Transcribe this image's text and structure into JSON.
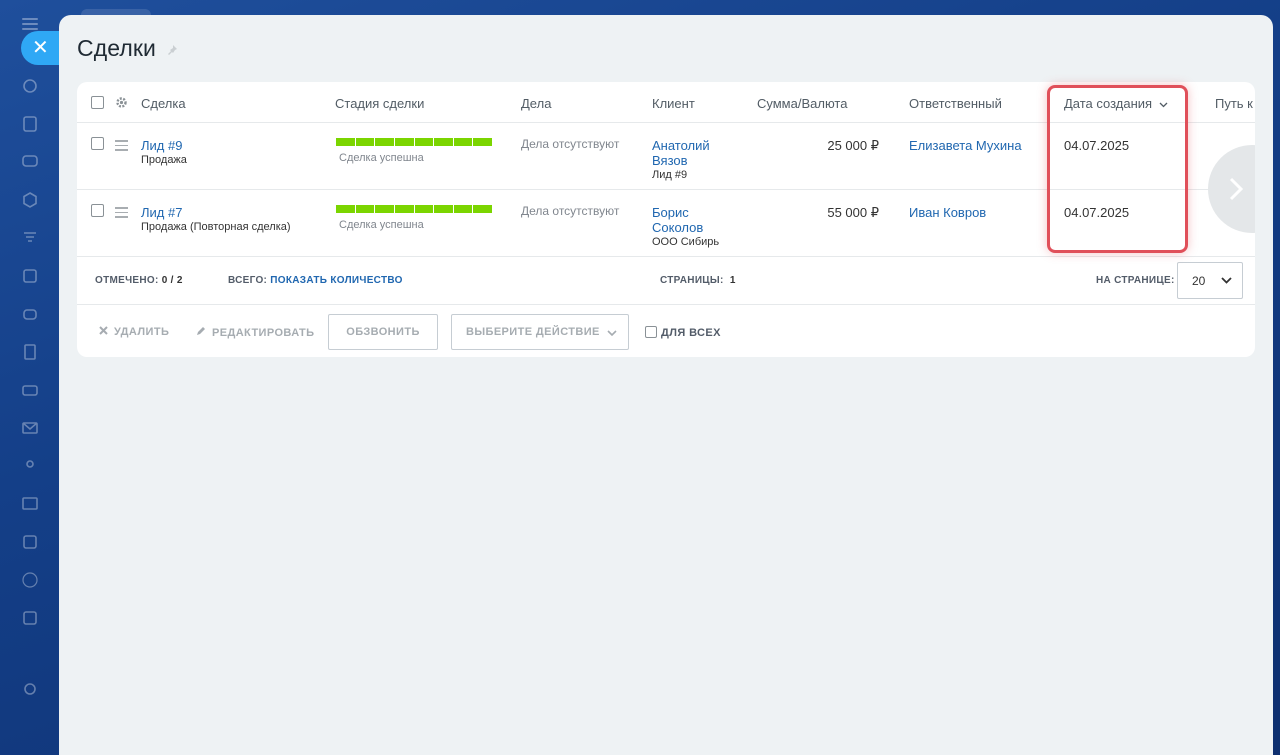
{
  "page": {
    "title": "Сделки"
  },
  "table": {
    "headers": {
      "deal": "Сделка",
      "stage": "Стадия сделки",
      "activities": "Дела",
      "client": "Клиент",
      "amount": "Сумма/Валюта",
      "responsible": "Ответственный",
      "created": "Дата создания",
      "path": "Путь к"
    },
    "rows": [
      {
        "title": "Лид #9",
        "type": "Продажа",
        "stage_label": "Сделка успешна",
        "activities": "Дела отсутствуют",
        "client_line1": "Анатолий",
        "client_line2": "Вязов",
        "client_sub": "Лид #9",
        "amount": "25 000 ₽",
        "responsible": "Елизавета Мухина",
        "created": "04.07.2025"
      },
      {
        "title": "Лид #7",
        "type": "Продажа (Повторная сделка)",
        "stage_label": "Сделка успешна",
        "activities": "Дела отсутствуют",
        "client_line1": "Борис",
        "client_line2": "Соколов",
        "client_sub": "ООО Сибирь",
        "amount": "55 000 ₽",
        "responsible": "Иван Ковров",
        "created": "04.07.2025"
      }
    ]
  },
  "footer": {
    "selected_label": "ОТМЕЧЕНО:",
    "selected_value": "0 / 2",
    "total_label": "ВСЕГО:",
    "total_link": "ПОКАЗАТЬ КОЛИЧЕСТВО",
    "pages_label": "СТРАНИЦЫ:",
    "pages_value": "1",
    "per_page_label": "НА СТРАНИЦЕ:",
    "per_page_value": "20"
  },
  "actions": {
    "delete": "УДАЛИТЬ",
    "edit": "РЕДАКТИРОВАТЬ",
    "call": "ОБЗВОНИТЬ",
    "choose_action": "ВЫБЕРИТЕ ДЕЙСТВИЕ",
    "for_all": "ДЛЯ ВСЕХ"
  },
  "colors": {
    "accent": "#2067b0",
    "stage_success": "#7bd500",
    "highlight": "#e0505a"
  }
}
